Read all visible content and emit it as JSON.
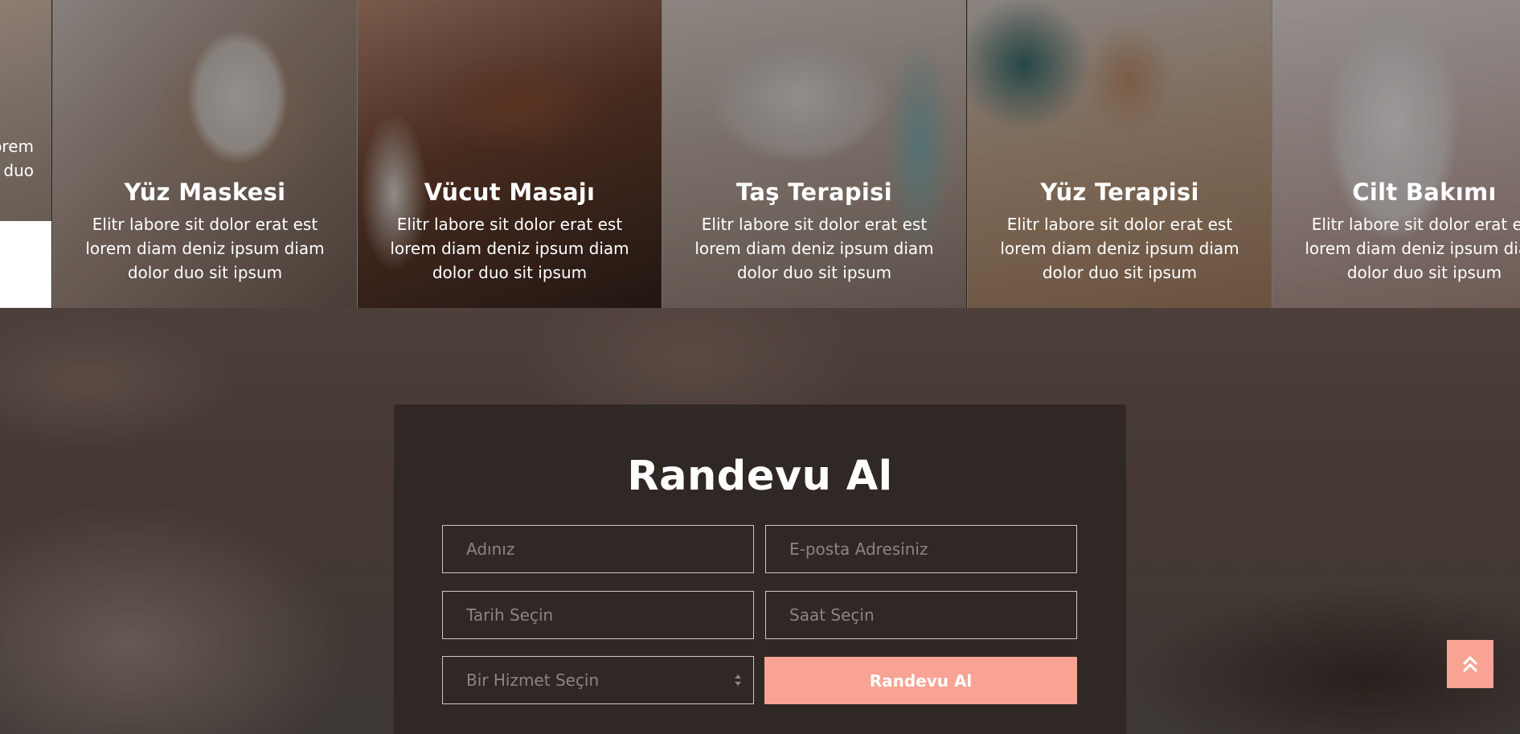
{
  "services": {
    "partial": {
      "desc_lines": [
        "orem",
        "duo"
      ]
    },
    "cards": [
      {
        "title": "Yüz Maskesi",
        "desc": "Elitr labore sit dolor erat est lorem diam deniz ipsum diam dolor duo sit ipsum"
      },
      {
        "title": "Vücut Masajı",
        "desc": "Elitr labore sit dolor erat est lorem diam deniz ipsum diam dolor duo sit ipsum"
      },
      {
        "title": "Taş Terapisi",
        "desc": "Elitr labore sit dolor erat est lorem diam deniz ipsum diam dolor duo sit ipsum"
      },
      {
        "title": "Yüz Terapisi",
        "desc": "Elitr labore sit dolor erat est lorem diam deniz ipsum diam dolor duo sit ipsum"
      },
      {
        "title": "Cilt Bakımı",
        "desc": "Elitr labore sit dolor erat est lorem diam deniz ipsum diam dolor duo sit ipsum"
      }
    ]
  },
  "booking": {
    "title": "Randevu Al",
    "name_placeholder": "Adınız",
    "email_placeholder": "E-posta Adresiniz",
    "date_placeholder": "Tarih Seçin",
    "time_placeholder": "Saat Seçin",
    "service_select_value": "Bir Hizmet Seçin",
    "submit_label": "Randevu Al"
  },
  "accent_color": "#f8a393",
  "icons": {
    "back_to_top": "double-chevron-up-icon",
    "select": "select-arrows-icon"
  }
}
